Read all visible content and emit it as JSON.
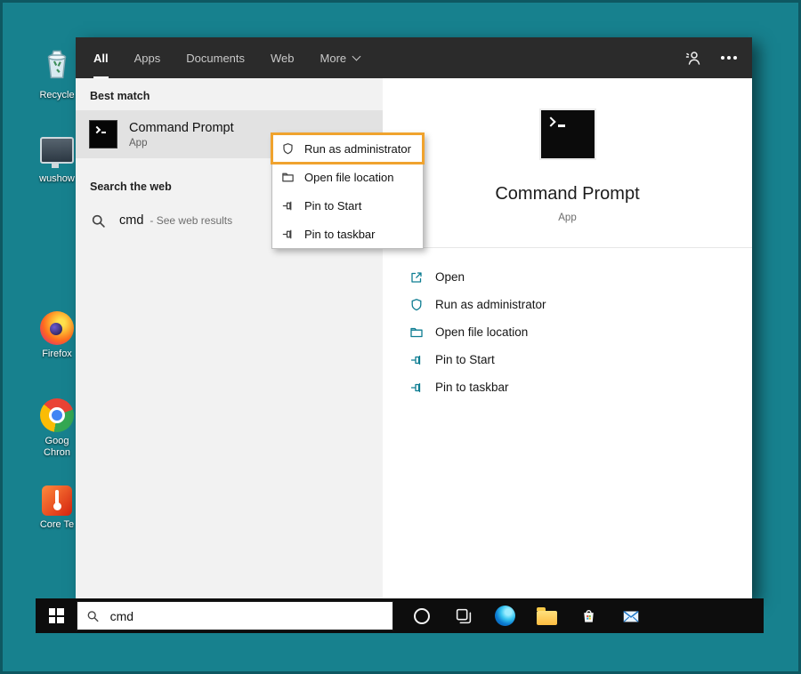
{
  "colors": {
    "desktop_background": "#17818e",
    "accent_icons": "#0e7d92",
    "annotation_highlight": "#f0a32e",
    "taskbar_background": "#0d0d0d",
    "topbar_background": "#2b2b2b"
  },
  "desktop": {
    "icons": [
      {
        "label": "Recycle"
      },
      {
        "label": "wushow"
      },
      {
        "label": "Firefox"
      },
      {
        "label": "Goog Chron"
      },
      {
        "label": "Core Te"
      }
    ]
  },
  "search_flyout": {
    "tabs": [
      {
        "label": "All",
        "selected": true
      },
      {
        "label": "Apps",
        "selected": false
      },
      {
        "label": "Documents",
        "selected": false
      },
      {
        "label": "Web",
        "selected": false
      },
      {
        "label": "More",
        "selected": false
      }
    ],
    "sections": {
      "best_match_title": "Best match",
      "web_title": "Search the web"
    },
    "best_match": {
      "title": "Command Prompt",
      "subtitle": "App"
    },
    "web_result": {
      "term": "cmd",
      "suffix": "- See web results"
    },
    "context_menu": {
      "items": [
        {
          "label": "Run as administrator",
          "annotated": true
        },
        {
          "label": "Open file location",
          "annotated": false
        },
        {
          "label": "Pin to Start",
          "annotated": false
        },
        {
          "label": "Pin to taskbar",
          "annotated": false
        }
      ]
    },
    "preview": {
      "title": "Command Prompt",
      "subtitle": "App",
      "actions": [
        {
          "label": "Open"
        },
        {
          "label": "Run as administrator"
        },
        {
          "label": "Open file location"
        },
        {
          "label": "Pin to Start"
        },
        {
          "label": "Pin to taskbar"
        }
      ]
    }
  },
  "taskbar": {
    "search_value": "cmd"
  }
}
